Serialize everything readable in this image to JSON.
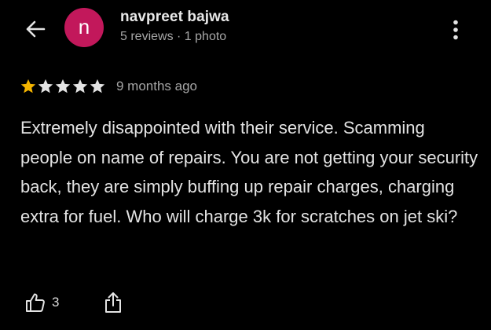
{
  "reviewer": {
    "initial": "n",
    "name": "navpreet bajwa",
    "meta": "5 reviews · 1 photo",
    "avatar_color": "#c2185b"
  },
  "review": {
    "rating": 1,
    "max_rating": 5,
    "time": "9 months ago",
    "text": "Extremely disappointed with their service. Scamming people on name of repairs. You are not getting your security back, they are simply buffing up repair charges, charging extra for fuel. Who will charge 3k for scratches on jet ski?"
  },
  "actions": {
    "like_count": "3"
  },
  "icons": {
    "back": "arrow-back-icon",
    "more": "more-vert-icon",
    "like": "thumb-up-icon",
    "share": "share-icon"
  },
  "colors": {
    "background": "#000000",
    "star_filled": "#f4b400",
    "star_empty": "#e3e3e3",
    "text_primary": "#e3e3e3",
    "text_secondary": "#a7a7a7"
  }
}
